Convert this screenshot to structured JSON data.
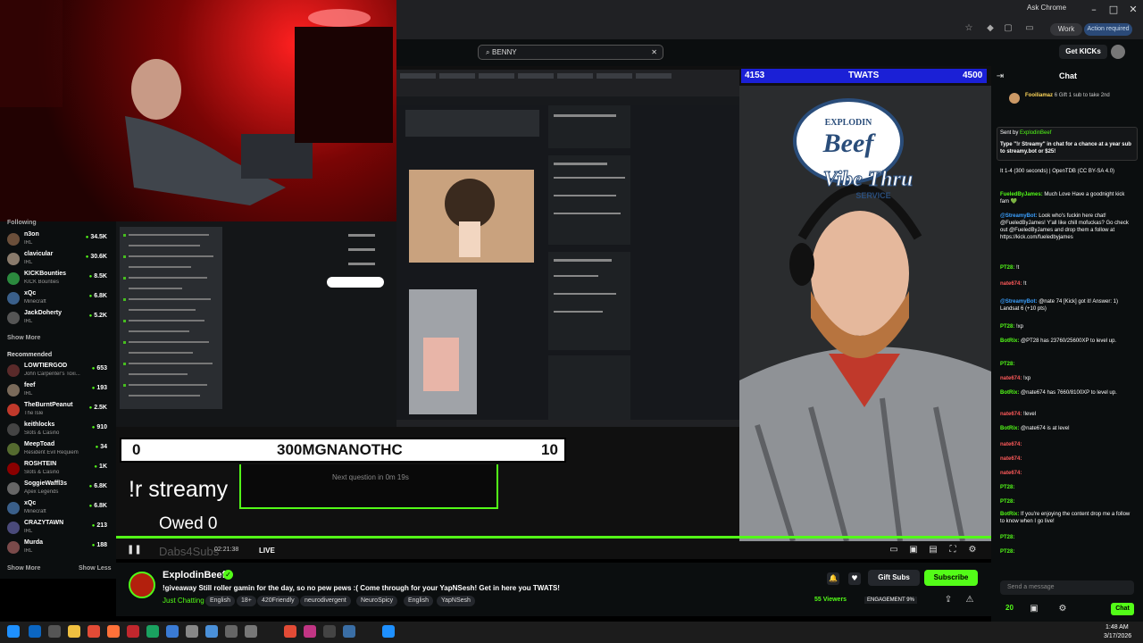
{
  "browser": {
    "ask_chrome": "Ask Chrome",
    "profile": "Work",
    "action_required": "Action required"
  },
  "kick_header": {
    "search_value": "BENNY",
    "get_kicks": "Get KICKs"
  },
  "sidebar": {
    "following_label": "Following",
    "following": [
      {
        "name": "n3on",
        "category": "IRL",
        "viewers": "34.5K",
        "color": "#6b4f3a"
      },
      {
        "name": "clavicular",
        "category": "IRL",
        "viewers": "30.6K",
        "color": "#8a7b6c"
      },
      {
        "name": "KICKBounties",
        "category": "KICK Bounties",
        "viewers": "8.5K",
        "color": "#2b8a3e"
      },
      {
        "name": "xQc",
        "category": "Minecraft",
        "viewers": "6.8K",
        "color": "#3a5f8a"
      },
      {
        "name": "JackDoherty",
        "category": "IRL",
        "viewers": "5.2K",
        "color": "#555"
      }
    ],
    "show_more_1": "Show More",
    "recommended_label": "Recommended",
    "recommended": [
      {
        "name": "LOWTIERGOD",
        "category": "John Carpenter's Toxi...",
        "viewers": "653",
        "color": "#5a2a2a"
      },
      {
        "name": "feef",
        "category": "IRL",
        "viewers": "193",
        "color": "#7a6a5a"
      },
      {
        "name": "TheBurntPeanut",
        "category": "The Isle",
        "viewers": "2.5K",
        "color": "#c0392b"
      },
      {
        "name": "keithlocks",
        "category": "Slots & Casino",
        "viewers": "910",
        "color": "#444"
      },
      {
        "name": "MeepToad",
        "category": "Resident Evil Requiem",
        "viewers": "34",
        "color": "#556b2f"
      },
      {
        "name": "ROSHTEIN",
        "category": "Slots & Casino",
        "viewers": "1K",
        "color": "#8b0000"
      },
      {
        "name": "SoggieWaffl3s",
        "category": "Apex Legends",
        "viewers": "6.8K",
        "color": "#666"
      },
      {
        "name": "xQc",
        "category": "Minecraft",
        "viewers": "6.8K",
        "color": "#3a5f8a"
      },
      {
        "name": "CRAZYTAWN",
        "category": "IRL",
        "viewers": "213",
        "color": "#4a4a7a"
      },
      {
        "name": "Murda",
        "category": "IRL",
        "viewers": "188",
        "color": "#7a4a4a"
      }
    ],
    "show_more_2": "Show More",
    "show_less": "Show Less"
  },
  "overlay": {
    "twats_left": "4153",
    "twats_label": "TWATS",
    "twats_right": "4500",
    "score_left": "0",
    "score_name": "300MGNANOTHC",
    "score_right": "10",
    "command": "!r streamy",
    "next_question": "Next question in 0m 19s",
    "owed": "Owed 0",
    "subs_goal": "Dabs4Subs",
    "logo_top": "EXPLODIN",
    "logo_beef": "Beef",
    "logo_vibe": "Vibe Thru",
    "logo_service": "SERVICE"
  },
  "player": {
    "live": "LIVE",
    "time": "02:21:38"
  },
  "channel": {
    "name": "ExplodinBeef",
    "title": "!giveaway Still roller gamin for the day, so no pew pews :( Come through for your YapNSesh! Get in here you TWATS!",
    "category": "Just Chatting",
    "tags": [
      "English",
      "18+",
      "420Friendly",
      "neurodivergent",
      "NeuroSpicy",
      "English",
      "YapNSesh"
    ],
    "gift_subs": "Gift Subs",
    "subscribe": "Subscribe",
    "viewers": "55 Viewers",
    "engagement": "ENGAGEMENT",
    "engagement_pct": "9%"
  },
  "chat": {
    "title": "Chat",
    "top_gifter_name": "Fooiliamaz",
    "top_gifter_count": "6",
    "top_gifter_text": "Gift 1 sub to take 2nd",
    "pinned_sent_by": "Sent by",
    "pinned_author": "ExplodinBeef",
    "pinned_text": "Type \"!r Streamy\" in chat for a chance at a year sub to streamy.bot or $25!",
    "messages": [
      {
        "user": "",
        "text": "It 1-4 (300 seconds) | OpenTDB (CC BY-SA 4.0)",
        "color": "#fff"
      },
      {
        "user": "FueledByJames:",
        "text": "Much Love Have a goodnight kick fam 💚",
        "color": "#53fc18"
      },
      {
        "user": "@StreamyBot:",
        "text": "Look who's fuckin here chat! @FueledByJames! Y'all like chill mofuckas? Go check out @FueledByJames and drop them a follow at https://kick.com/fueledbyjames",
        "color": "#3aa0ff"
      },
      {
        "user": "PT28:",
        "text": "!t",
        "color": "#53fc18"
      },
      {
        "user": "nate674:",
        "text": "!t",
        "color": "#ff5a5a"
      },
      {
        "user": "@StreamyBot:",
        "text": "@nate 74 [Kick] got it! Answer: 1) Landsat 6 (+10 pts)",
        "color": "#3aa0ff"
      },
      {
        "user": "PT28:",
        "text": "!xp",
        "color": "#53fc18"
      },
      {
        "user": "BotRix:",
        "text": "@PT28 has 23760/25600XP to level up.",
        "color": "#53fc18"
      },
      {
        "user": "PT28:",
        "text": "",
        "color": "#53fc18"
      },
      {
        "user": "nate674:",
        "text": "!xp",
        "color": "#ff5a5a"
      },
      {
        "user": "BotRix:",
        "text": "@nate674 has 7660/8100XP to level up.",
        "color": "#53fc18"
      },
      {
        "user": "nate674:",
        "text": "!level",
        "color": "#ff5a5a"
      },
      {
        "user": "BotRix:",
        "text": "@nate674 is at level",
        "color": "#53fc18"
      },
      {
        "user": "nate674:",
        "text": "",
        "color": "#ff5a5a"
      },
      {
        "user": "nate674:",
        "text": "",
        "color": "#ff5a5a"
      },
      {
        "user": "nate674:",
        "text": "",
        "color": "#ff5a5a"
      },
      {
        "user": "PT28:",
        "text": "",
        "color": "#53fc18"
      },
      {
        "user": "PT28:",
        "text": "",
        "color": "#53fc18"
      },
      {
        "user": "BotRix:",
        "text": "If you're enjoying the content drop me a follow to know when I go live!",
        "color": "#53fc18"
      },
      {
        "user": "PT28:",
        "text": "",
        "color": "#53fc18"
      },
      {
        "user": "PT28:",
        "text": "",
        "color": "#53fc18"
      }
    ],
    "input_placeholder": "Send a message",
    "kick_count": "20",
    "chat_button": "Chat"
  },
  "taskbar": {
    "time": "1:48 AM",
    "date": "3/17/2026"
  },
  "colors": {
    "kick_green": "#53fc18",
    "twats_blue": "#1b20d6"
  }
}
